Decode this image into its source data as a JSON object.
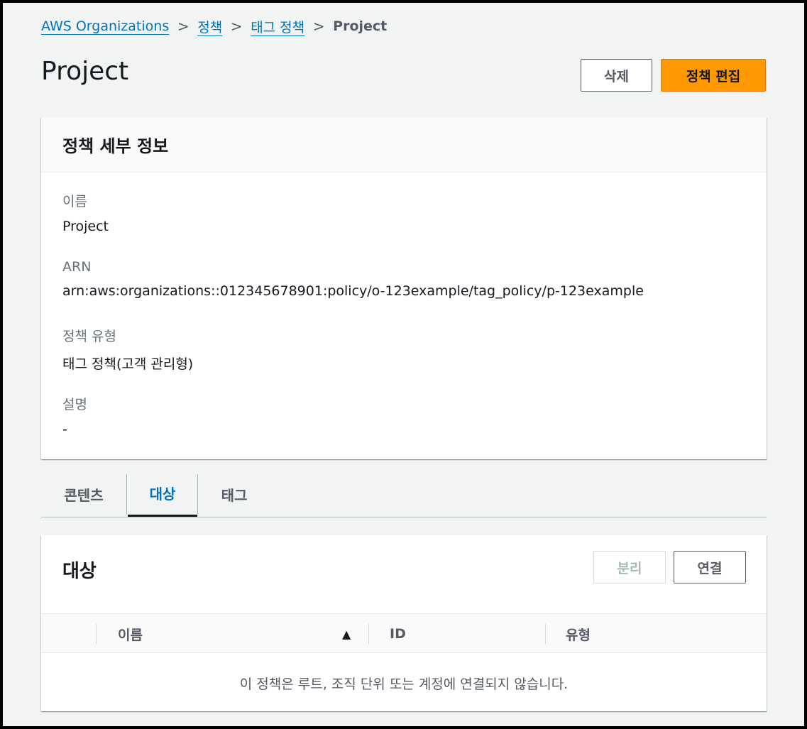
{
  "breadcrumb": {
    "items": [
      "AWS Organizations",
      "정책",
      "태그 정책"
    ],
    "current": "Project",
    "separator": ">"
  },
  "page": {
    "title": "Project",
    "delete_label": "삭제",
    "edit_label": "정책 편집"
  },
  "details": {
    "header": "정책 세부 정보",
    "name_label": "이름",
    "name_value": "Project",
    "arn_label": "ARN",
    "arn_value": "arn:aws:organizations::012345678901:policy/o-123example/tag_policy/p-123example",
    "type_label": "정책 유형",
    "type_value": "태그 정책(고객 관리형)",
    "desc_label": "설명",
    "desc_value": "-"
  },
  "tabs": [
    {
      "label": "콘텐츠",
      "active": false
    },
    {
      "label": "대상",
      "active": true
    },
    {
      "label": "태그",
      "active": false
    }
  ],
  "targets": {
    "header": "대상",
    "detach_label": "분리",
    "attach_label": "연결",
    "columns": [
      "이름",
      "ID",
      "유형"
    ],
    "sort_indicator": "▲",
    "empty_message": "이 정책은 루트, 조직 단위 또는 계정에 연결되지 않습니다."
  },
  "colors": {
    "link": "#0073bb",
    "primary_button": "#ff9900",
    "background": "#f2f3f3"
  }
}
